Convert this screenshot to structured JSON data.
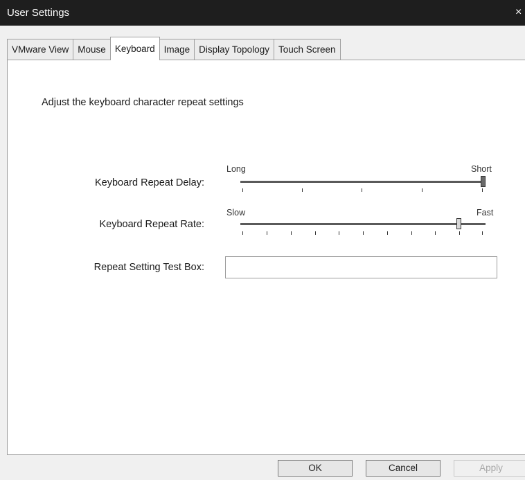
{
  "window": {
    "title": "User Settings",
    "close_glyph": "×"
  },
  "tabs": [
    {
      "label": "VMware View"
    },
    {
      "label": "Mouse"
    },
    {
      "label": "Keyboard"
    },
    {
      "label": "Image"
    },
    {
      "label": "Display Topology"
    },
    {
      "label": "Touch Screen"
    }
  ],
  "active_tab": "Keyboard",
  "keyboard": {
    "heading": "Adjust the keyboard character repeat settings",
    "repeat_delay": {
      "label": "Keyboard Repeat Delay:",
      "min_label": "Long",
      "max_label": "Short",
      "value_fraction": 1.0
    },
    "repeat_rate": {
      "label": "Keyboard Repeat Rate:",
      "min_label": "Slow",
      "max_label": "Fast",
      "value_fraction": 0.9
    },
    "test_box": {
      "label": "Repeat Setting Test Box:",
      "value": ""
    }
  },
  "buttons": {
    "ok": "OK",
    "cancel": "Cancel",
    "apply": "Apply"
  }
}
